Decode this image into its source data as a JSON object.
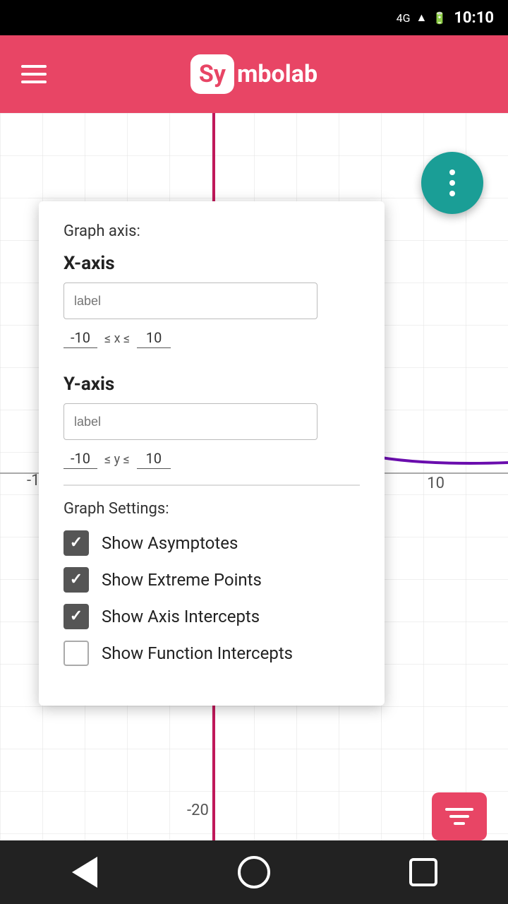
{
  "statusBar": {
    "network": "4G",
    "battery": "🔋",
    "time": "10:10"
  },
  "header": {
    "logoSy": "Sy",
    "logoRest": "mbolab",
    "menuLabel": "menu"
  },
  "graphAxis": {
    "title": "Graph axis:",
    "xAxis": {
      "label": "X-axis",
      "inputPlaceholder": "label",
      "minValue": "-10",
      "maxValue": "10",
      "variable": "x"
    },
    "yAxis": {
      "label": "Y-axis",
      "inputPlaceholder": "label",
      "minValue": "-10",
      "maxValue": "10",
      "variable": "y"
    }
  },
  "graphSettings": {
    "title": "Graph Settings:",
    "options": [
      {
        "id": "asymptotes",
        "label": "Show Asymptotes",
        "checked": true
      },
      {
        "id": "extreme-points",
        "label": "Show Extreme Points",
        "checked": true
      },
      {
        "id": "axis-intercepts",
        "label": "Show Axis Intercepts",
        "checked": true
      },
      {
        "id": "function-intercepts",
        "label": "Show Function Intercepts",
        "checked": false
      }
    ]
  },
  "graphLabels": {
    "pos10": "10",
    "neg20": "-20",
    "neg1": "-1"
  },
  "bottomNav": {
    "back": "back",
    "home": "home",
    "recents": "recents"
  }
}
